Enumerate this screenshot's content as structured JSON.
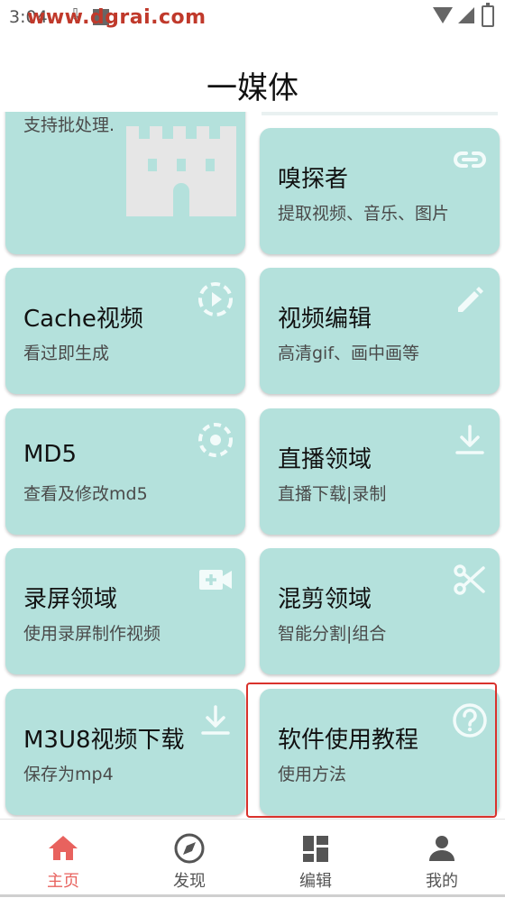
{
  "status_bar": {
    "time": "3:04"
  },
  "watermark": "www.dgrai.com",
  "header": {
    "title": "一媒体"
  },
  "cards": [
    {
      "title": "",
      "subtitle": "支持批处理.",
      "icon": "castle-icon"
    },
    {
      "title": "嗅探者",
      "subtitle": "提取视频、音乐、图片",
      "icon": "link-icon"
    },
    {
      "title": "Cache视频",
      "subtitle": "看过即生成",
      "icon": "play-circle-icon"
    },
    {
      "title": "视频编辑",
      "subtitle": "高清gif、画中画等",
      "icon": "pencil-icon"
    },
    {
      "title": "MD5",
      "subtitle": "查看及修改md5",
      "icon": "target-icon"
    },
    {
      "title": "直播领域",
      "subtitle": "直播下载|录制",
      "icon": "download-icon"
    },
    {
      "title": "录屏领域",
      "subtitle": "使用录屏制作视频",
      "icon": "video-add-icon"
    },
    {
      "title": "混剪领域",
      "subtitle": "智能分割|组合",
      "icon": "scissors-icon"
    },
    {
      "title": "M3U8视频下载",
      "subtitle": "保存为mp4",
      "icon": "download-icon"
    },
    {
      "title": "软件使用教程",
      "subtitle": "使用方法",
      "icon": "help-circle-icon"
    }
  ],
  "bottom_nav": [
    {
      "label": "主页",
      "icon": "home-icon",
      "active": true
    },
    {
      "label": "发现",
      "icon": "compass-icon",
      "active": false
    },
    {
      "label": "编辑",
      "icon": "grid-icon",
      "active": false
    },
    {
      "label": "我的",
      "icon": "person-icon",
      "active": false
    }
  ],
  "colors": {
    "card_bg": "#b4e1dc",
    "accent": "#e8625e",
    "highlight_border": "#d9322c",
    "icon_white": "#f2fbfa"
  }
}
